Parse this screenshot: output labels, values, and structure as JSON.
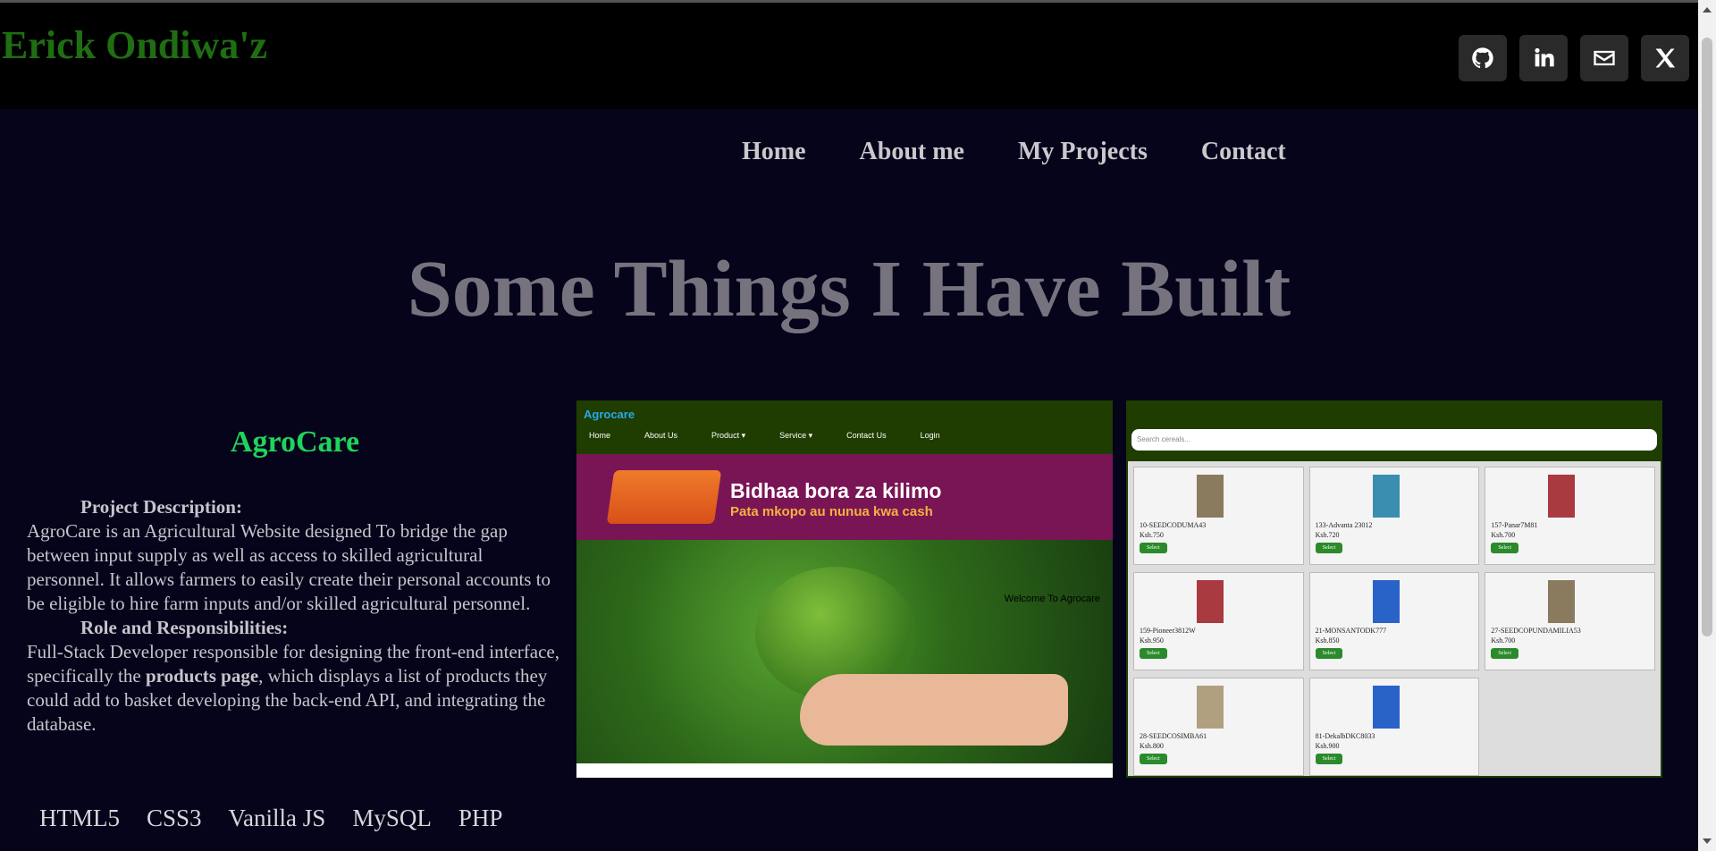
{
  "header": {
    "brand": "Erick Ondiwa'z",
    "social": [
      "github-icon",
      "linkedin-icon",
      "email-icon",
      "x-icon"
    ]
  },
  "nav": {
    "items": [
      "Home",
      "About me",
      "My Projects",
      "Contact"
    ]
  },
  "headline": "Some Things I Have Built",
  "project": {
    "title": "AgroCare",
    "desc_heading": "Project Description:",
    "desc": "AgroCare is an Agricultural Website designed To bridge the gap between input supply as well as access to skilled agricultural personnel. It allows farmers to easily create their personal accounts to be eligible to hire farm inputs and/or skilled agricultural personnel.",
    "role_heading": "Role and Responsibilities:",
    "role_pre": "Full-Stack Developer responsible for designing the front-end interface, specifically the ",
    "role_bold": "products page",
    "role_post": ", which displays a list of products they could add to basket developing the back-end API, and integrating the database.",
    "tags": [
      "HTML5",
      "CSS3",
      "Vanilla JS",
      "MySQL",
      "PHP"
    ]
  },
  "screenshot1": {
    "logo": "Agrocare",
    "nav": [
      "Home",
      "About Us",
      "Product ▾",
      "Service ▾",
      "Contact Us",
      "Login"
    ],
    "banner_title": "Bidhaa bora za kilimo",
    "banner_sub": "Pata mkopo au nunua kwa cash",
    "welcome": "Welcome To Agrocare"
  },
  "screenshot2": {
    "search_placeholder": "Search cereals...",
    "button_label": "Select",
    "products": [
      {
        "name": "10-SEEDCODUMA43",
        "price": "Ksh.750"
      },
      {
        "name": "133-Advanta 23012",
        "price": "Ksh.720"
      },
      {
        "name": "157-Panar7M81",
        "price": "Ksh.700"
      },
      {
        "name": "159-Pioneer3812W",
        "price": "Ksh.950"
      },
      {
        "name": "21-MONSANTODK777",
        "price": "Ksh.850"
      },
      {
        "name": "27-SEEDCOPUNDAMILIA53",
        "price": "Ksh.700"
      },
      {
        "name": "28-SEEDCOSIMBA61",
        "price": "Ksh.800"
      },
      {
        "name": "81-DekalbDKC8033",
        "price": "Ksh.900"
      }
    ]
  }
}
